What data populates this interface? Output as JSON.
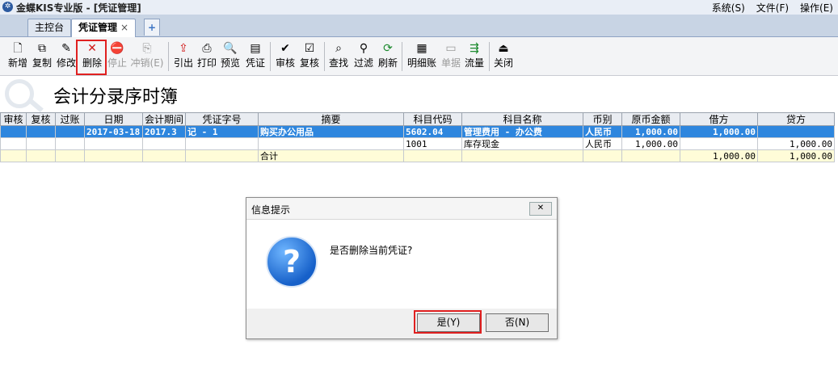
{
  "window": {
    "app_title": "金蝶KIS专业版 - [凭证管理]",
    "logo_glyph": "✲"
  },
  "menus": [
    "系统(S)",
    "文件(F)",
    "操作(E)"
  ],
  "tabs": [
    {
      "label": "主控台",
      "active": false
    },
    {
      "label": "凭证管理",
      "active": true,
      "close": "×"
    }
  ],
  "tab_add_glyph": "+",
  "toolbar": {
    "buttons": [
      {
        "id": "new",
        "label": "新增",
        "icon": "🗋"
      },
      {
        "id": "copy",
        "label": "复制",
        "icon": "⧉"
      },
      {
        "id": "edit",
        "label": "修改",
        "icon": "✎"
      },
      {
        "id": "delete",
        "label": "删除",
        "icon": "✕"
      },
      {
        "id": "stop",
        "label": "停止",
        "icon": "⛔"
      },
      {
        "id": "reverse",
        "label": "冲销(E)",
        "icon": "⎘"
      },
      {
        "id": "export",
        "label": "引出",
        "icon": "⇪"
      },
      {
        "id": "print",
        "label": "打印",
        "icon": "⎙"
      },
      {
        "id": "preview",
        "label": "预览",
        "icon": "🔍"
      },
      {
        "id": "voucher",
        "label": "凭证",
        "icon": "▤"
      },
      {
        "id": "audit",
        "label": "审核",
        "icon": "✔"
      },
      {
        "id": "review",
        "label": "复核",
        "icon": "☑"
      },
      {
        "id": "find",
        "label": "查找",
        "icon": "⌕"
      },
      {
        "id": "filter",
        "label": "过滤",
        "icon": "⚲"
      },
      {
        "id": "refresh",
        "label": "刷新",
        "icon": "⟳"
      },
      {
        "id": "detail",
        "label": "明细账",
        "icon": "▦"
      },
      {
        "id": "document",
        "label": "单据",
        "icon": "▭"
      },
      {
        "id": "flow",
        "label": "流量",
        "icon": "⇶"
      },
      {
        "id": "close",
        "label": "关闭",
        "icon": "⏏"
      }
    ]
  },
  "report": {
    "title": "会计分录序时簿"
  },
  "grid": {
    "columns": [
      "审核",
      "复核",
      "过账",
      "日期",
      "会计期间",
      "凭证字号",
      "摘要",
      "科目代码",
      "科目名称",
      "币别",
      "原币金额",
      "借方",
      "贷方"
    ],
    "rows": [
      [
        "",
        "",
        "",
        "2017-03-18",
        "2017.3",
        "记 - 1",
        "购买办公用品",
        "5602.04",
        "管理费用 - 办公费",
        "人民币",
        "1,000.00",
        "1,000.00",
        ""
      ],
      [
        "",
        "",
        "",
        "",
        "",
        "",
        "",
        "1001",
        "库存现金",
        "人民币",
        "1,000.00",
        "",
        "1,000.00"
      ],
      [
        "",
        "",
        "",
        "",
        "",
        "",
        "合计",
        "",
        "",
        "",
        "",
        "1,000.00",
        "1,000.00"
      ]
    ]
  },
  "dialog": {
    "title": "信息提示",
    "close_glyph": "✕",
    "icon_glyph": "?",
    "message": "是否删除当前凭证?",
    "yes_label": "是(Y)",
    "no_label": "否(N)"
  }
}
